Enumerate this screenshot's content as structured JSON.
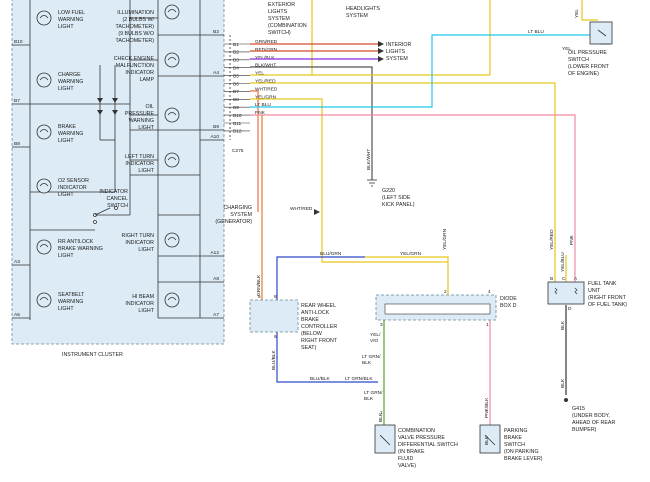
{
  "cluster": {
    "title": "INSTRUMENT CLUSTER",
    "left_pins": [
      "B10",
      "B7",
      "B8",
      "A3",
      "A5"
    ],
    "right_pins": [
      "B2",
      "A4",
      "B9",
      "A10",
      "A12",
      "A8",
      "A7"
    ],
    "lights_left": [
      [
        "LOW FUEL",
        "WARNING",
        "LIGHT"
      ],
      [
        "CHARGE",
        "WARNING",
        "LIGHT"
      ],
      [
        "BRAKE",
        "WARNING",
        "LIGHT"
      ],
      [
        "O2 SENSOR",
        "INDICATOR",
        "LIGHT"
      ],
      [
        "RR ANTILOCK",
        "BRAKE WARNING",
        "LIGHT"
      ],
      [
        "SEATBELT",
        "WARNING",
        "LIGHT"
      ]
    ],
    "lights_right": [
      [
        "ILLUMINATION",
        "(2 BULBS W/",
        "TACHOMETER)",
        "(9 BULBS W/O",
        "TACHOMETER)"
      ],
      [
        "CHECK ENGINE",
        "MALFUNCTION",
        "INDICATOR",
        "LAMP"
      ],
      [
        "OIL",
        "PRESSURE",
        "WARNING",
        "LIGHT"
      ],
      [
        "LEFT TURN",
        "INDICATOR",
        "LIGHT"
      ],
      [
        "RIGHT TURN",
        "INDICATOR",
        "LIGHT"
      ],
      [
        "HI BEAM",
        "INDICATOR",
        "LIGHT"
      ]
    ],
    "indicator_cancel_switch": [
      "INDICATOR",
      "CANCEL",
      "SWITCH"
    ]
  },
  "connector": {
    "name": "C275",
    "pins": [
      {
        "pin": "B1",
        "wire": "GRN/RED",
        "color": "#d24a2e"
      },
      {
        "pin": "B2",
        "wire": "RED/GRN",
        "color": "#d24a2e"
      },
      {
        "pin": "B3",
        "wire": "YEL/BLK",
        "color": "#8a2be2"
      },
      {
        "pin": "B4",
        "wire": "BLK/WHT",
        "color": "#555555"
      },
      {
        "pin": "B5",
        "wire": "YEL",
        "color": "#e6c61a"
      },
      {
        "pin": "B6",
        "wire": "YEL/RED",
        "color": "#e6c61a"
      },
      {
        "pin": "B7",
        "wire": "WHT/RED",
        "color": "#e8704a"
      },
      {
        "pin": "B8",
        "wire": "YEL/GRN",
        "color": "#e6c61a"
      },
      {
        "pin": "B9",
        "wire": "LT BLU",
        "color": "#1ec8e8"
      },
      {
        "pin": "B10",
        "wire": "PNK",
        "color": "#f08aa0"
      },
      {
        "pin": "B11",
        "wire": "",
        "color": "#888888"
      },
      {
        "pin": "B12",
        "wire": "",
        "color": "#888888"
      }
    ]
  },
  "components": {
    "exterior_lights": [
      "EXTERIOR",
      "LIGHTS",
      "SYSTEM",
      "(COMBINATION",
      "SWITCH)"
    ],
    "headlights": [
      "HEADLIGHTS",
      "SYSTEM"
    ],
    "interior_lights": [
      "INTERIOR",
      "LIGHTS",
      "SYSTEM"
    ],
    "oil_pressure_switch": [
      "OIL PRESSURE",
      "SWITCH",
      "(LOWER FRONT",
      "OF ENGINE)"
    ],
    "g220": [
      "G220",
      "(LEFT SIDE",
      "KICK PANEL)"
    ],
    "charging_system": [
      "CHARGING",
      "SYSTEM",
      "(GENERATOR)"
    ],
    "rwal_controller": [
      "REAR WHEEL",
      "ANTI-LOCK",
      "BRAKE",
      "CONTROLLER",
      "(BELOW",
      "RIGHT FRONT",
      "SEAT)"
    ],
    "diode_box": [
      "DIODE",
      "BOX D"
    ],
    "fuel_tank_unit": [
      "FUEL TANK",
      "UNIT",
      "(RIGHT FRONT",
      "OF FUEL TANK)"
    ],
    "g415": [
      "G415",
      "(UNDER BODY,",
      "AHEAD OF REAR",
      "BUMPER)"
    ],
    "combination_valve": [
      "COMBINATION",
      "VALVE PRESSURE",
      "DIFFERENTIAL SWITCH",
      "(IN BRAKE",
      "FLUID",
      "VALVE)"
    ],
    "parking_brake_switch": [
      "PARKING",
      "BRAKE",
      "SWITCH",
      "(ON PARKING",
      "BRAKE LEVER)"
    ]
  },
  "wire_labels": {
    "yel_top": "YEL",
    "lt_blu_top": "LT BLU",
    "yel_oil": "YEL",
    "blk_wht_vert": "BLK/WHT",
    "wht_red_charge": "WHT/RED",
    "yel_grn_vert": "YEL/GRN",
    "grn_red_vert": "GRN/BLK",
    "blu_grn_left": "BLU/GRN",
    "yel_grn_mid": "YEL/GRN",
    "yel_red_vert": "YEL/RED",
    "yel_blu_vert": "YEL/BLU",
    "pnk_vert": "PNK",
    "yel_vio": [
      "YEL/",
      "VIO"
    ],
    "lt_grn_blk_a": [
      "LT GRN/",
      "BLK"
    ],
    "blu_blk_vert": "BLU/BLK",
    "blu_blk_h": "BLU/BLK",
    "lt_grn_blk_h": "LT GRN/BLK",
    "lt_grn_blk_b": [
      "LT GRN/",
      "BLK"
    ],
    "pnk_blk": "PNK/BLK",
    "blk_cv": "BLK",
    "blk_pb": "BLK",
    "blk_fuel": "BLK",
    "blk_g415": "BLK"
  },
  "pin_numbers": {
    "rwal_left": "5",
    "rwal_right": "8",
    "rwal_bottom": "6",
    "diode_top_left": "2",
    "diode_top_right": "4",
    "diode_bottom_left": "3",
    "diode_bottom_right": "1",
    "cv_top": "1",
    "fuel_b": "B",
    "fuel_c": "C",
    "fuel_a": "A",
    "fuel_d": "D"
  }
}
